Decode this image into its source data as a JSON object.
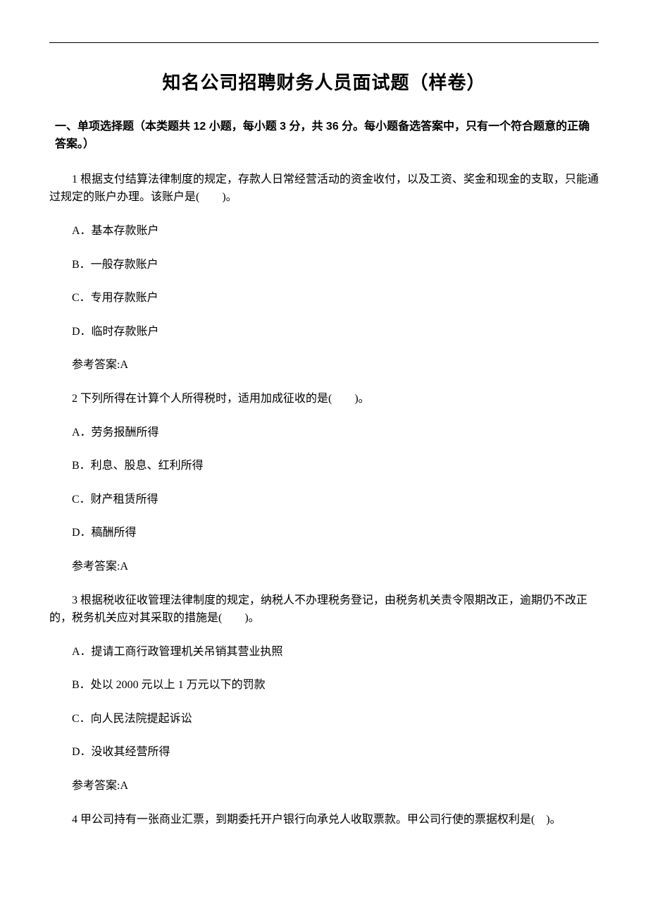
{
  "title": "知名公司招聘财务人员面试题（样卷）",
  "section": {
    "heading": "一、单项选择题（本类题共 12 小题，每小题 3 分，共 36 分。每小题备选答案中，只有一个符合题意的正确答案。）"
  },
  "questions": [
    {
      "stem": "1 根据支付结算法律制度的规定，存款人日常经营活动的资金收付，以及工资、奖金和现金的支取，只能通过规定的账户办理。该账户是(　　)。",
      "options": {
        "A": "A．基本存款账户",
        "B": "B．一般存款账户",
        "C": "C．专用存款账户",
        "D": "D．临时存款账户"
      },
      "answer": "参考答案:A"
    },
    {
      "stem": "2 下列所得在计算个人所得税时，适用加成征收的是(　　)。",
      "options": {
        "A": "A．劳务报酬所得",
        "B": "B．利息、股息、红利所得",
        "C": "C．财产租赁所得",
        "D": "D．稿酬所得"
      },
      "answer": "参考答案:A"
    },
    {
      "stem": "3 根据税收征收管理法律制度的规定，纳税人不办理税务登记，由税务机关责令限期改正，逾期仍不改正的，税务机关应对其采取的措施是(　　)。",
      "options": {
        "A": "A．提请工商行政管理机关吊销其营业执照",
        "B": "B．处以 2000 元以上 1 万元以下的罚款",
        "C": "C．向人民法院提起诉讼",
        "D": "D．没收其经营所得"
      },
      "answer": "参考答案:A"
    },
    {
      "stem": "4 甲公司持有一张商业汇票，到期委托开户银行向承兑人收取票款。甲公司行使的票据权利是(　)。"
    }
  ]
}
